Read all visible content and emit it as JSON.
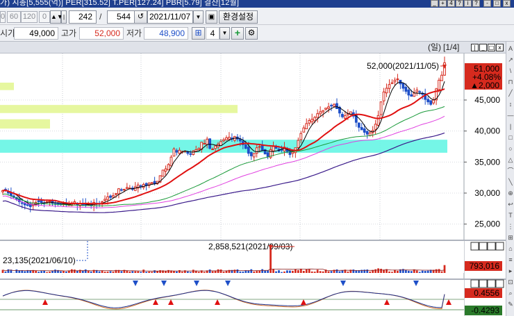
{
  "window": {
    "title_fragment": "가) 시총[5,555(억)] PER[315.52] T.PER[127.24] PBR[5.79] 결산[12월]",
    "buttons": [
      "_",
      "+",
      "4",
      "?",
      "i",
      "?",
      "-",
      "□",
      "x"
    ]
  },
  "toolbar1": {
    "periods": [
      "0",
      "60",
      "120",
      "0"
    ],
    "current": "242",
    "separator": "/",
    "total": "544",
    "date": "2021/11/07",
    "settings_label": "환경설정"
  },
  "toolbar2": {
    "prev_label": "시가",
    "open_value": "49,000",
    "high_label": "고가",
    "high_value": "52,000",
    "low_label": "저가",
    "low_value": "48,900",
    "grid_count": "4"
  },
  "chart_header": {
    "period_label": "(일)",
    "page_label": "[1/4]"
  },
  "price_panel": {
    "max_annotation": "52,000(2021/11/05)",
    "current_price": "51,000",
    "change_pct": "+4.08%",
    "change_abs": "▲2,000",
    "y_ticks": [
      "45,000",
      "40,000",
      "35,000",
      "30,000",
      "25,000"
    ]
  },
  "volume_panel": {
    "max_annotation": "2,858,521(2021/09/03)",
    "min_annotation": "23,135(2021/06/10)",
    "current_volume": "793,016"
  },
  "osc_panel": {
    "current_value": "0.4556",
    "min_value": "-0.4293"
  },
  "right_tools": [
    "A",
    "↗",
    "\\",
    "⊓",
    "╱",
    "↕",
    "—",
    "|",
    "□",
    "○",
    "△",
    "⌒",
    "╲",
    "⊕",
    "↩",
    "T",
    "⋮",
    "⊞",
    "⌂",
    "≡",
    "▸",
    "⊡",
    "⌕",
    "✎"
  ],
  "colors": {
    "titlebar": "#1e3f8f",
    "up": "#d62a1e",
    "down": "#1e4fc8",
    "ma5": "#000000",
    "ma20": "#e01010",
    "ma60": "#1a9a3a",
    "ma120": "#e040e0",
    "ma240": "#3a1a8a",
    "band_yellow": "#e5f79a",
    "band_cyan": "#6ef5e6"
  },
  "chart_data": [
    {
      "type": "candlestick",
      "x_range_dates": [
        "2021/05",
        "2021/11/05"
      ],
      "ylim": [
        22500,
        52500
      ],
      "y_ticks": [
        45000,
        40000,
        35000,
        30000,
        25000
      ],
      "max": {
        "value": 52000,
        "date": "2021/11/05"
      },
      "last": {
        "close": 51000,
        "open": 49000,
        "high": 52000,
        "low": 48900,
        "change_pct": 4.08,
        "change": 2000
      },
      "highlight_bands": [
        {
          "color": "yellow",
          "range": [
            46600,
            47800
          ]
        },
        {
          "color": "yellow",
          "range": [
            42900,
            44200
          ]
        },
        {
          "color": "yellow",
          "range": [
            40400,
            41900
          ]
        },
        {
          "color": "cyan",
          "range": [
            36500,
            38600
          ]
        }
      ],
      "closes": [
        30400,
        30500,
        30000,
        29600,
        29300,
        29000,
        28600,
        28400,
        28100,
        28000,
        27800,
        28400,
        28500,
        28600,
        28400,
        28300,
        28600,
        28700,
        28400,
        28300,
        28200,
        28100,
        28300,
        28200,
        28100,
        28400,
        28600,
        28100,
        28300,
        28100,
        28000,
        28200,
        28000,
        28500,
        28300,
        28200,
        28600,
        29000,
        29400,
        29300,
        29600,
        29900,
        30700,
        30500,
        30600,
        30900,
        30800,
        30600,
        31000,
        31300,
        31100,
        31400,
        31200,
        31600,
        31700,
        31500,
        31900,
        32800,
        33700,
        33900,
        34600,
        35800,
        37100,
        36600,
        36900,
        36700,
        36800,
        36400,
        36300,
        36800,
        37000,
        37200,
        38200,
        38000,
        38700,
        37200,
        37100,
        37600,
        37900,
        38300,
        38600,
        38900,
        39000,
        38700,
        39100,
        38700,
        38400,
        37800,
        37200,
        36400,
        36000,
        36400,
        37300,
        37500,
        36900,
        36300,
        35900,
        37000,
        37500,
        37200,
        36800,
        37000,
        37400,
        36700,
        36200,
        36600,
        37300,
        38500,
        39600,
        40500,
        41200,
        41700,
        41900,
        42200,
        42800,
        43100,
        43300,
        43700,
        43900,
        44100,
        44300,
        43600,
        42900,
        42300,
        42500,
        42800,
        43100,
        42400,
        41400,
        40600,
        40200,
        39800,
        39500,
        39700,
        40100,
        41100,
        42500,
        44700,
        46300,
        46900,
        47500,
        47800,
        48200,
        48400,
        47600,
        46900,
        46400,
        45800,
        45600,
        46100,
        46600,
        46300,
        45900,
        45100,
        44700,
        44300,
        45000,
        46800,
        48200,
        49000,
        51000
      ]
    },
    {
      "type": "bar",
      "name": "volume",
      "max": {
        "value": 2858521,
        "date": "2021/09/03"
      },
      "min": {
        "value": 23135,
        "date": "2021/06/10"
      },
      "last": 793016
    },
    {
      "type": "line",
      "name": "oscillator",
      "last": 0.4556,
      "min": -0.4293
    }
  ]
}
